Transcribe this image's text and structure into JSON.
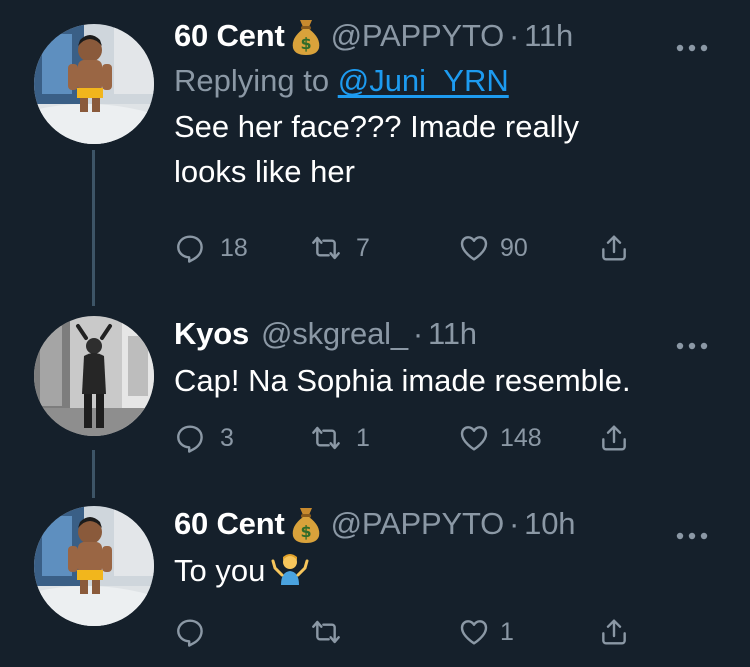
{
  "colors": {
    "background": "#15202b",
    "text": "#ffffff",
    "muted": "#8b98a5",
    "link": "#1d9bf0",
    "thread_line": "#3d5466"
  },
  "tweets": [
    {
      "display_name": "60 Cent",
      "name_badge": "money-bag-emoji",
      "handle": "@PAPPYTO",
      "separator": "·",
      "time": "11h",
      "reply_prefix": "Replying to",
      "reply_to": "@Juni_YRN",
      "text": "See her face??? Imade really looks like her",
      "reply_count": "18",
      "retweet_count": "7",
      "like_count": "90"
    },
    {
      "display_name": "Kyos",
      "handle": "@skgreal_",
      "separator": "·",
      "time": "11h",
      "text": "Cap! Na Sophia imade resemble.",
      "reply_count": "3",
      "retweet_count": "1",
      "like_count": "148"
    },
    {
      "display_name": "60 Cent",
      "name_badge": "money-bag-emoji",
      "handle": "@PAPPYTO",
      "separator": "·",
      "time": "10h",
      "text": "To you",
      "text_emoji": "person-shrugging-emoji",
      "reply_count": "",
      "retweet_count": "",
      "like_count": "1"
    }
  ]
}
